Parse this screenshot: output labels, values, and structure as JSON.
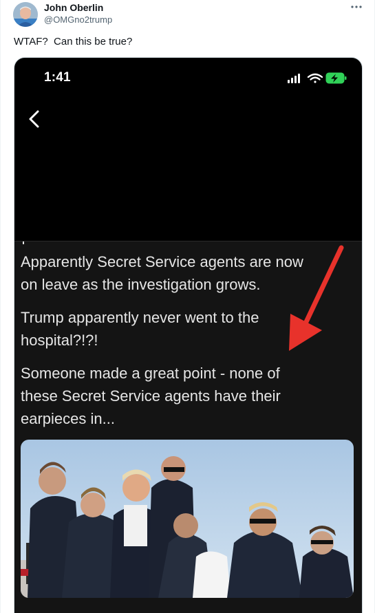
{
  "tweet": {
    "author_name": "John Oberlin",
    "author_handle": "@OMGno2trump",
    "text": "WTAF?  Can this be true?",
    "more_icon": "more-horizontal-icon"
  },
  "media": {
    "status_bar": {
      "time": "1:41",
      "icons": [
        "signal-icon",
        "wifi-icon",
        "battery-charging-icon"
      ],
      "battery_color": "#30d158"
    },
    "back_icon": "chevron-left-icon",
    "post_lines": [
      "Apparently Secret Service agents are now",
      "on leave as the investigation grows.",
      "Trump apparently never went to the",
      "hospital?!?!",
      "Someone made a great point - none of",
      "these Secret Service agents have their",
      "earpieces in..."
    ],
    "arrow_color": "#e8322b"
  },
  "colors": {
    "text_primary": "#0f1419",
    "text_secondary": "#536471",
    "border": "#cfd9de"
  }
}
